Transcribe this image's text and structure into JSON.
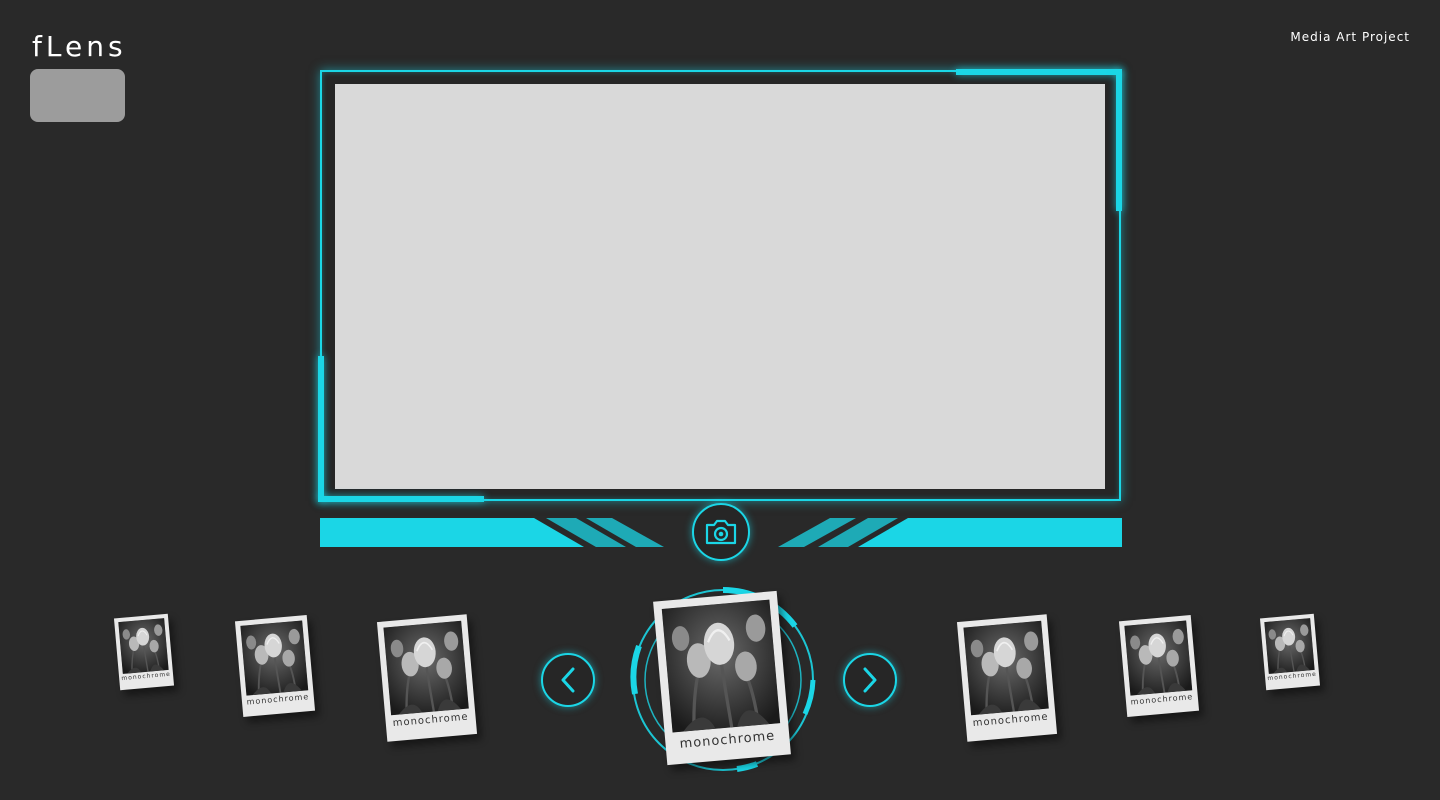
{
  "app": {
    "logo": "fLens",
    "project_label": "Media Art Project"
  },
  "colors": {
    "background": "#292929",
    "accent": "#1bd6e6",
    "screen": "#d9d9d9",
    "logo_box": "#9c9c9c"
  },
  "viewer": {
    "state": "empty"
  },
  "controls": {
    "capture_icon": "camera-icon",
    "prev_icon": "chevron-left-icon",
    "next_icon": "chevron-right-icon"
  },
  "carousel": {
    "selected_index": 3,
    "items": [
      {
        "caption": "monochrome"
      },
      {
        "caption": "monochrome"
      },
      {
        "caption": "monochrome"
      },
      {
        "caption": "monochrome"
      },
      {
        "caption": "monochrome"
      },
      {
        "caption": "monochrome"
      },
      {
        "caption": "monochrome"
      }
    ]
  }
}
